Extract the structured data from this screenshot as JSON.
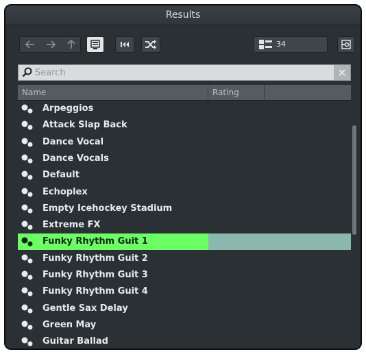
{
  "window": {
    "title": "Results"
  },
  "toolbar": {
    "back_icon": "arrow-left-icon",
    "forward_icon": "arrow-right-icon",
    "up_icon": "arrow-up-icon",
    "result_count": "34"
  },
  "search": {
    "placeholder": "Search",
    "value": ""
  },
  "columns": {
    "name": "Name",
    "rating": "Rating",
    "extra": ""
  },
  "results": [
    {
      "name": "Arpeggios"
    },
    {
      "name": "Attack Slap Back"
    },
    {
      "name": "Dance Vocal"
    },
    {
      "name": "Dance Vocals"
    },
    {
      "name": "Default"
    },
    {
      "name": "Echoplex"
    },
    {
      "name": "Empty Icehockey Stadium"
    },
    {
      "name": "Extreme FX"
    },
    {
      "name": "Funky Rhythm Guit 1",
      "selected": true
    },
    {
      "name": "Funky Rhythm Guit 2"
    },
    {
      "name": "Funky Rhythm Guit 3"
    },
    {
      "name": "Funky Rhythm Guit 4"
    },
    {
      "name": "Gentle Sax Delay"
    },
    {
      "name": "Green May"
    },
    {
      "name": "Guitar Ballad"
    }
  ],
  "colors": {
    "selected_row": "#6cff63",
    "selected_row_rest": "#8ab8ad",
    "panel_bg": "#2b3034"
  }
}
